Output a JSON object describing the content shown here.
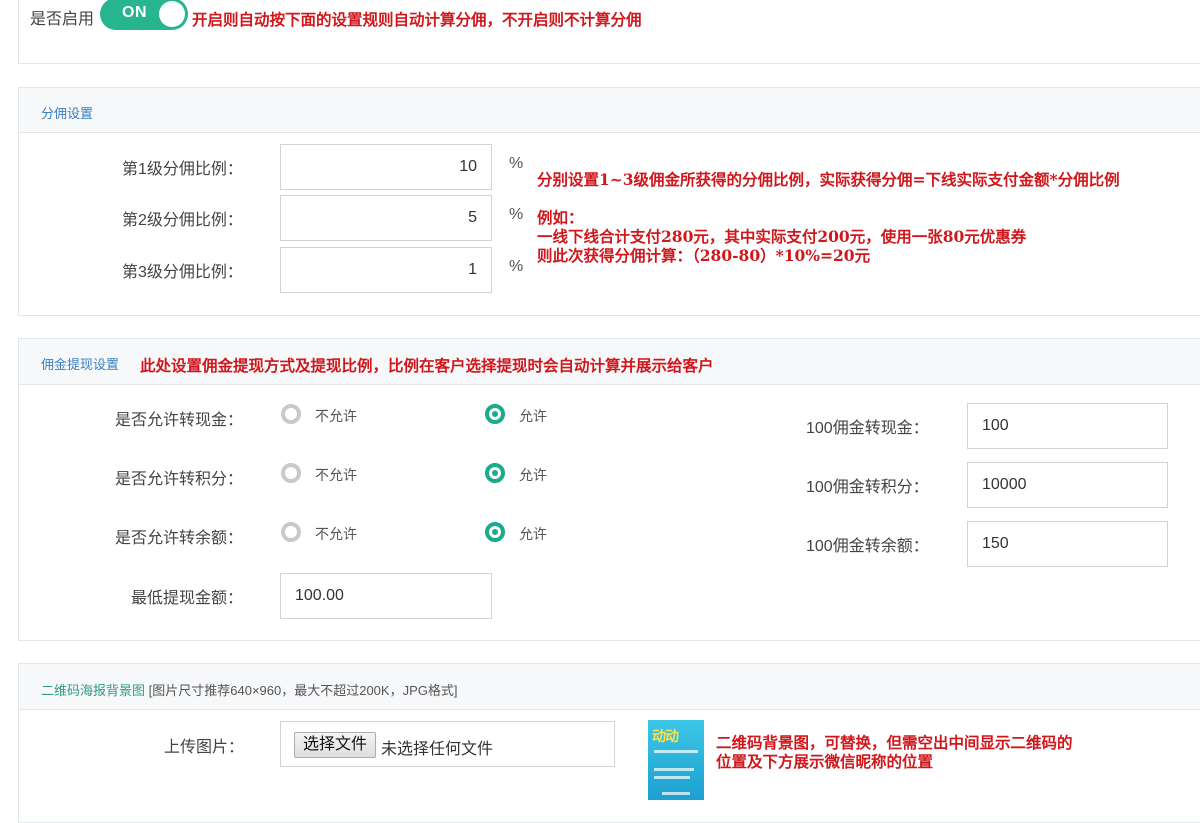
{
  "enable": {
    "label": "是否启用",
    "toggle_text": "ON",
    "note": "开启则自动按下面的设置规则自动计算分佣，不开启则不计算分佣"
  },
  "commission": {
    "title": "分佣设置",
    "rows": [
      {
        "label": "第1级分佣比例：",
        "value": "10",
        "unit": "%"
      },
      {
        "label": "第2级分佣比例：",
        "value": "5",
        "unit": "%"
      },
      {
        "label": "第3级分佣比例：",
        "value": "1",
        "unit": "%"
      }
    ],
    "note_line1": "分别设置1~3级佣金所获得的分佣比例，实际获得分佣=下线实际支付金额*分佣比例",
    "note_line2": "例如：",
    "note_line3": "一线下线合计支付280元，其中实际支付200元，使用一张80元优惠券",
    "note_line4": "则此次获得分佣计算：（280-80）*10%=20元"
  },
  "withdraw": {
    "title": "佣金提现设置",
    "note": "此处设置佣金提现方式及提现比例，比例在客户选择提现时会自动计算并展示给客户",
    "rows": [
      {
        "label": "是否允许转现金：",
        "opt_no": "不允许",
        "opt_yes": "允许",
        "selected": "允许",
        "rate_label": "100佣金转现金：",
        "rate_value": "100"
      },
      {
        "label": "是否允许转积分：",
        "opt_no": "不允许",
        "opt_yes": "允许",
        "selected": "允许",
        "rate_label": "100佣金转积分：",
        "rate_value": "10000"
      },
      {
        "label": "是否允许转余额：",
        "opt_no": "不允许",
        "opt_yes": "允许",
        "selected": "允许",
        "rate_label": "100佣金转余额：",
        "rate_value": "150"
      }
    ],
    "min_label": "最低提现金额：",
    "min_value": "100.00"
  },
  "qrcode": {
    "title": "二维码海报背景图",
    "hint": "[图片尺寸推荐640×960，最大不超过200K，JPG格式]",
    "upload_label": "上传图片：",
    "file_button": "选择文件",
    "file_status": "未选择任何文件",
    "thumb_text": "动动",
    "note_line1": "二维码背景图，可替换，但需空出中间显示二维码的",
    "note_line2": "位置及下方展示微信昵称的位置"
  },
  "colors": {
    "accent": "#27b58f",
    "radio": "#1aaa8c",
    "note": "#d0171c",
    "head_title": "#3a7fc1"
  }
}
